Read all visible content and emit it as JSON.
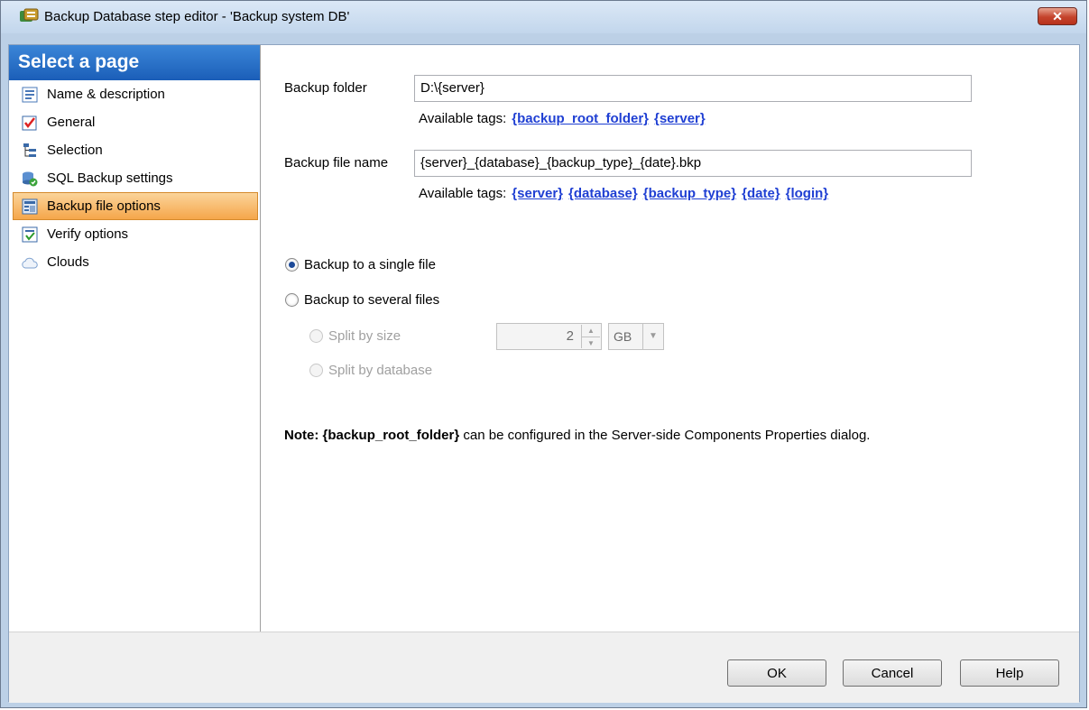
{
  "window": {
    "title": "Backup Database step editor - 'Backup system DB'",
    "close_label": "✕"
  },
  "sidebar": {
    "header": "Select a page",
    "items": [
      {
        "label": "Name & description",
        "icon": "document-icon"
      },
      {
        "label": "General",
        "icon": "checklist-icon"
      },
      {
        "label": "Selection",
        "icon": "tree-icon"
      },
      {
        "label": "SQL Backup settings",
        "icon": "database-check-icon"
      },
      {
        "label": "Backup file options",
        "icon": "file-options-icon",
        "active": true
      },
      {
        "label": "Verify options",
        "icon": "verify-icon"
      },
      {
        "label": "Clouds",
        "icon": "cloud-icon"
      }
    ]
  },
  "main": {
    "backup_folder": {
      "label": "Backup folder",
      "value": "D:\\{server}",
      "tags_label": "Available tags:",
      "tags": [
        "{backup_root_folder}",
        "{server}"
      ]
    },
    "backup_file_name": {
      "label": "Backup file name",
      "value": "{server}_{database}_{backup_type}_{date}.bkp",
      "tags_label": "Available tags:",
      "tags": [
        "{server}",
        "{database}",
        "{backup_type}",
        "{date}",
        "{login}"
      ]
    },
    "options": {
      "single_file": "Backup to a single file",
      "several_files": "Backup to several files",
      "split_by_size": "Split by size",
      "split_by_database": "Split by database",
      "split_size_value": "2",
      "split_size_unit": "GB"
    },
    "note": {
      "prefix": "Note:",
      "tag": "{backup_root_folder}",
      "text": "can be configured in the Server-side Components Properties dialog."
    }
  },
  "footer": {
    "ok": "OK",
    "cancel": "Cancel",
    "help": "Help"
  },
  "colors": {
    "header_blue": "#1b5eb8",
    "active_item": "#f5a64a",
    "link": "#1f3fd3"
  }
}
